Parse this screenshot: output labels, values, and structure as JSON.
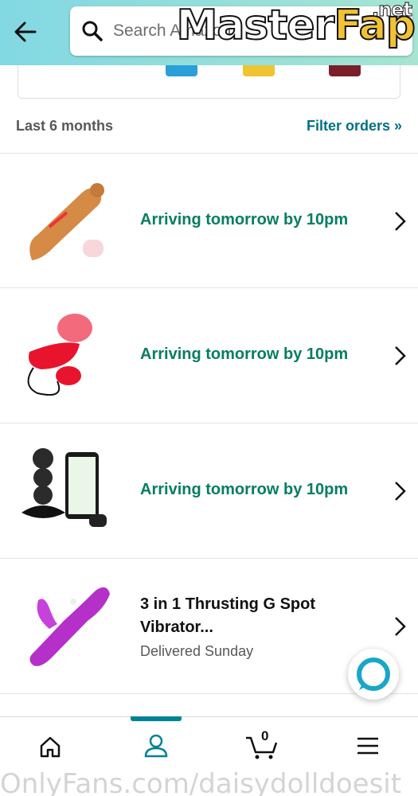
{
  "header": {
    "search_placeholder": "Search Amazon"
  },
  "watermark": {
    "top_part1": "Master",
    "top_part2": "Fap",
    "top_sup": ".net",
    "bottom": "OnlyFans.com/daisydolldoesit"
  },
  "orders_header": {
    "range": "Last 6 months",
    "filter": "Filter orders »"
  },
  "orders": [
    {
      "status": "Arriving tomorrow by 10pm",
      "image_icon": "product-thumbnail"
    },
    {
      "status": "Arriving tomorrow by 10pm",
      "image_icon": "product-thumbnail"
    },
    {
      "status": "Arriving tomorrow by 10pm",
      "image_icon": "product-thumbnail"
    },
    {
      "title": "3 in 1 Thrusting G Spot Vibrator...",
      "delivery": "Delivered Sunday",
      "image_icon": "product-thumbnail"
    }
  ],
  "bottom_nav": {
    "items": [
      "home-icon",
      "account-icon",
      "cart-icon",
      "menu-icon"
    ],
    "cart_count": "0",
    "active_index": 1
  },
  "colors": {
    "header_gradient_start": "#82d8e3",
    "header_gradient_end": "#a6e5d1",
    "status_green": "#067d62",
    "link_teal": "#007185",
    "active_tab": "#008296"
  }
}
